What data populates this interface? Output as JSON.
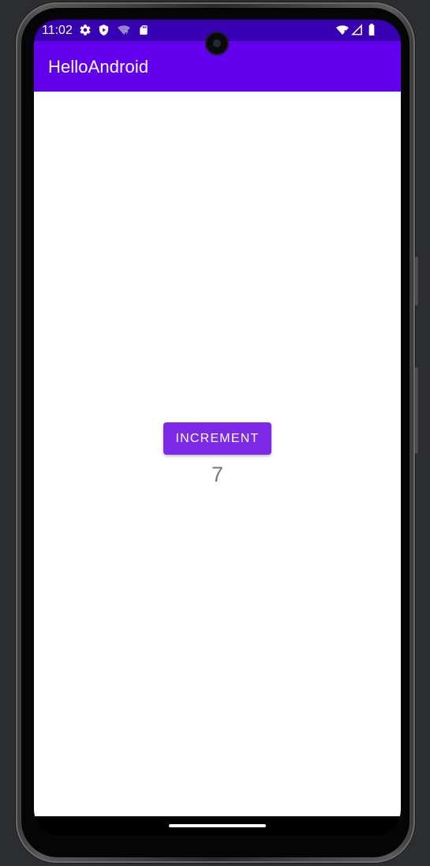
{
  "status_bar": {
    "time": "11:02",
    "background": "#3700b3",
    "left_icons": [
      "settings-icon",
      "play-protect-icon",
      "wifi-question-icon",
      "sd-card-icon"
    ],
    "right_icons": [
      "wifi-icon",
      "signal-icon",
      "battery-icon"
    ]
  },
  "app_bar": {
    "title": "HelloAndroid",
    "background": "#6200ee"
  },
  "main": {
    "increment_button": {
      "label": "INCREMENT",
      "color": "#7c2ae8"
    },
    "counter_value": "7"
  },
  "navigation": {
    "handle_icon": "gesture-nav-handle"
  }
}
